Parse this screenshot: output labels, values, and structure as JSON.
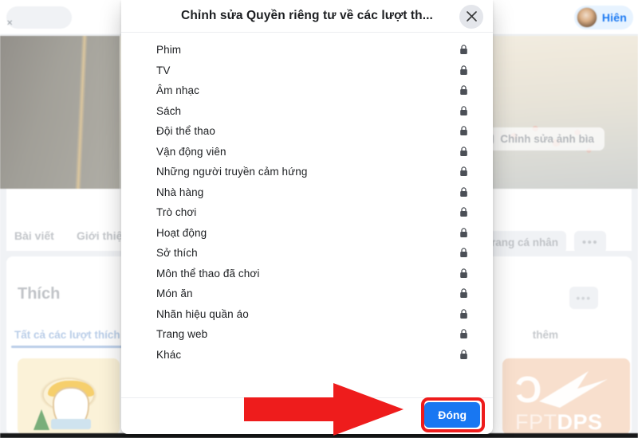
{
  "background": {
    "topbar": {
      "search_icon": "search-icon",
      "account_name": "Hiên",
      "avatar": "user-avatar"
    },
    "cover": {
      "edit_cover_label": "Chỉnh sửa ảnh bìa",
      "camera_icon": "camera-icon"
    },
    "tabs": [
      {
        "label": "Bài viết"
      },
      {
        "label": "Giới thiệu"
      }
    ],
    "profile_buttons": {
      "edit_profile_label": "trang cá nhân",
      "more_label": "•••"
    },
    "likes_panel": {
      "title": "Thích",
      "more_label": "•••",
      "active_subtab": "Tất cả các lượt thích",
      "more_tabs_label": "thêm",
      "cards": [
        {
          "name": "doodle-card"
        },
        {
          "name": "fpt-dps-card",
          "logo_light": "FPT",
          "logo_bold": "DPS"
        }
      ]
    }
  },
  "dialog": {
    "title": "Chỉnh sửa Quyền riêng tư về các lượt th...",
    "close_icon": "close-icon",
    "items": [
      {
        "label": "Phim",
        "privacy_icon": "lock-icon"
      },
      {
        "label": "TV",
        "privacy_icon": "lock-icon"
      },
      {
        "label": "Âm nhạc",
        "privacy_icon": "lock-icon"
      },
      {
        "label": "Sách",
        "privacy_icon": "lock-icon"
      },
      {
        "label": "Đội thể thao",
        "privacy_icon": "lock-icon"
      },
      {
        "label": "Vận động viên",
        "privacy_icon": "lock-icon"
      },
      {
        "label": "Những người truyền cảm hứng",
        "privacy_icon": "lock-icon"
      },
      {
        "label": "Nhà hàng",
        "privacy_icon": "lock-icon"
      },
      {
        "label": "Trò chơi",
        "privacy_icon": "lock-icon"
      },
      {
        "label": "Hoạt động",
        "privacy_icon": "lock-icon"
      },
      {
        "label": "Sở thích",
        "privacy_icon": "lock-icon"
      },
      {
        "label": "Môn thể thao đã chơi",
        "privacy_icon": "lock-icon"
      },
      {
        "label": "Món ăn",
        "privacy_icon": "lock-icon"
      },
      {
        "label": "Nhãn hiệu quần áo",
        "privacy_icon": "lock-icon"
      },
      {
        "label": "Trang web",
        "privacy_icon": "lock-icon"
      },
      {
        "label": "Khác",
        "privacy_icon": "lock-icon"
      }
    ],
    "footer": {
      "close_label": "Đóng"
    }
  },
  "annotations": {
    "arrow": {
      "name": "red-arrow-pointer",
      "color": "#ee1c1c",
      "direction": "right"
    },
    "highlight": {
      "name": "red-highlight-ring",
      "color": "#ee1c1c",
      "target": "close-button"
    }
  },
  "colors": {
    "accent_blue": "#1877f2",
    "annotation_red": "#ee1c1c",
    "dialog_bg": "#ffffff",
    "page_bg": "#f0f2f5",
    "text_primary": "#1c1e21",
    "lock_gray": "#4b4f56"
  }
}
